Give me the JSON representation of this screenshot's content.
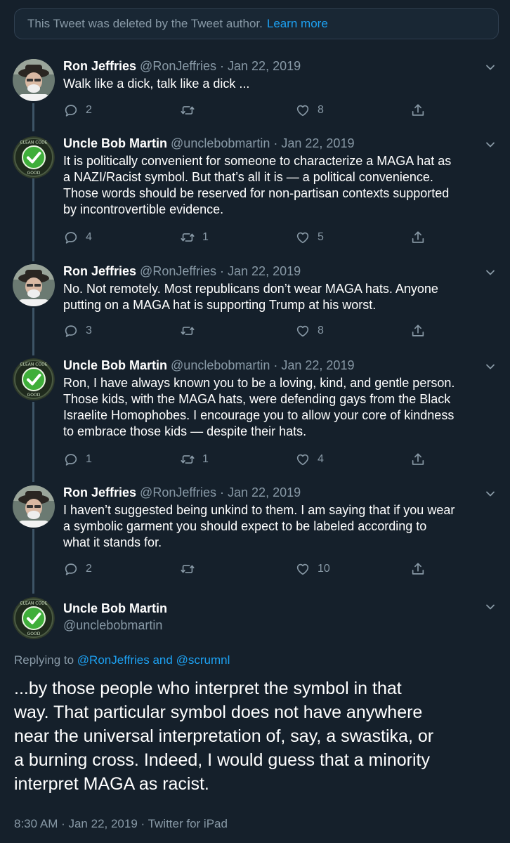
{
  "deleted_notice": {
    "text": "This Tweet was deleted by the Tweet author.",
    "link": "Learn more"
  },
  "tweets": [
    {
      "name": "Ron Jeffries",
      "meta": "@RonJeffries · Jan 22, 2019",
      "lines": [
        "Walk like a dick, talk like a dick ..."
      ],
      "replies": "2",
      "retweets": "",
      "likes": "8"
    },
    {
      "name": "Uncle Bob Martin",
      "meta": "@unclebobmartin · Jan 22, 2019",
      "lines": [
        "It is politically convenient for someone to characterize a MAGA hat as",
        "a NAZI/Racist symbol.  But that’s all it is — a political convenience.",
        "Those words should be reserved for non-partisan contexts supported",
        "by incontrovertible evidence."
      ],
      "replies": "4",
      "retweets": "1",
      "likes": "5"
    },
    {
      "name": "Ron Jeffries",
      "meta": "@RonJeffries · Jan 22, 2019",
      "lines": [
        "No. Not remotely. Most republicans don’t wear MAGA hats. Anyone",
        "putting on a MAGA hat is supporting Trump at his worst."
      ],
      "replies": "3",
      "retweets": "",
      "likes": "8"
    },
    {
      "name": "Uncle Bob Martin",
      "meta": "@unclebobmartin · Jan 22, 2019",
      "lines": [
        "Ron, I have always known you to be a loving, kind, and gentle person.",
        "Those kids, with the MAGA hats, were defending gays from the Black",
        "Israelite Homophobes.  I encourage you to allow your core of kindness",
        "to embrace those kids — despite their hats."
      ],
      "replies": "1",
      "retweets": "1",
      "likes": "4"
    },
    {
      "name": "Ron Jeffries",
      "meta": "@RonJeffries · Jan 22, 2019",
      "lines": [
        "I haven’t suggested being unkind to them. I am saying that if you wear",
        "a symbolic garment you should expect to be labeled according to",
        "what it stands for."
      ],
      "replies": "2",
      "retweets": "",
      "likes": "10"
    }
  ],
  "main_tweet": {
    "name": "Uncle Bob Martin",
    "handle": "@unclebobmartin",
    "replying_prefix": "Replying to",
    "replying_to_1": "@RonJeffries",
    "replying_and": "and",
    "replying_to_2": "@scrumnl",
    "lines": [
      "...by those people who interpret the symbol in that",
      "way.  That particular symbol does not have anywhere",
      "near the universal interpretation of, say, a swastika, or",
      "a burning cross.  Indeed, I would guess that a minority",
      "interpret MAGA as racist."
    ],
    "footer": "8:30 AM · Jan 22, 2019 · Twitter for iPad"
  },
  "colors": {
    "background": "#15202b",
    "link": "#1da1f2",
    "muted": "#8899a6"
  },
  "icons": [
    "reply-icon",
    "retweet-icon",
    "like-icon",
    "share-icon",
    "chevron-down-icon",
    "checkmark-icon"
  ]
}
